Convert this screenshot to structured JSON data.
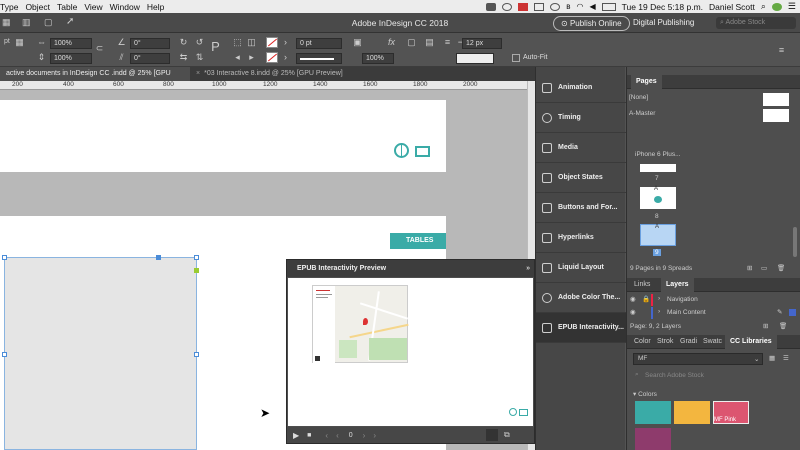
{
  "menubar": {
    "menus": [
      "Type",
      "Object",
      "Table",
      "View",
      "Window",
      "Help"
    ],
    "clock": "Tue 19 Dec  5:18 p.m.",
    "user": "Daniel Scott",
    "leading_fragment": "pt"
  },
  "appbar": {
    "title": "Adobe InDesign CC 2018",
    "publish_label": "Publish Online",
    "workspace_label": "Digital Publishing",
    "search_placeholder": "Adobe Stock"
  },
  "control_panel": {
    "scale_x": "100%",
    "scale_y": "100%",
    "rotate": "0°",
    "shear": "0°",
    "stroke_weight": "0 pt",
    "opacity": "100%",
    "size_field": "12 px",
    "autofit_label": "Auto-Fit"
  },
  "tabs": [
    {
      "label": "active documents in InDesign CC .indd @ 25% [GPU Preview]",
      "active": true
    },
    {
      "label": "*03 Interactive 8.indd @ 25% [GPU Preview]",
      "active": false
    }
  ],
  "ruler_ticks": [
    "200",
    "400",
    "600",
    "800",
    "1000",
    "1200",
    "1400",
    "1600",
    "1800",
    "2000"
  ],
  "canvas": {
    "tables_banner": "TABLES"
  },
  "dock": {
    "items": [
      "Animation",
      "Timing",
      "Media",
      "Object States",
      "Buttons and For...",
      "Hyperlinks",
      "Liquid Layout",
      "Adobe Color The...",
      "EPUB Interactivity..."
    ]
  },
  "pages_panel": {
    "title": "Pages",
    "none_label": "[None]",
    "master_label": "A-Master",
    "device_label": "iPhone 6 Plus...",
    "page_numbers": [
      "7",
      "8",
      "9"
    ],
    "master_badge": "A",
    "status": "9 Pages in 9 Spreads"
  },
  "layers_panel": {
    "tabs": [
      "Links",
      "Layers"
    ],
    "layers": [
      "Navigation",
      "Main Content"
    ],
    "status": "Page: 9, 2 Layers"
  },
  "libraries_panel": {
    "tabs": [
      "Color",
      "Strok",
      "Gradi",
      "Swatc",
      "CC Libraries"
    ],
    "library": "MF",
    "search_placeholder": "Search Adobe Stock",
    "section": "Colors",
    "swatch_label": "MF Pink",
    "colors": {
      "teal": "#3aaba7",
      "yellow": "#f3b63f",
      "pink": "#dc5570",
      "purple": "#8e3b6c"
    }
  },
  "epub_preview": {
    "title": "EPUB Interactivity Preview",
    "page_counter": "0"
  }
}
